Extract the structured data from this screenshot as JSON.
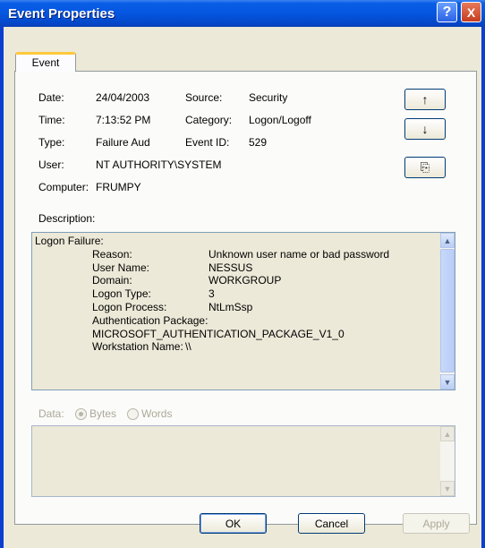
{
  "window": {
    "title": "Event Properties"
  },
  "title_buttons": {
    "help": "?",
    "close": "X"
  },
  "tabs": [
    {
      "label": "Event"
    }
  ],
  "fields": {
    "date_label": "Date:",
    "date_value": "24/04/2003",
    "source_label": "Source:",
    "source_value": "Security",
    "time_label": "Time:",
    "time_value": "7:13:52 PM",
    "category_label": "Category:",
    "category_value": "Logon/Logoff",
    "type_label": "Type:",
    "type_value": "Failure Aud",
    "eventid_label": "Event ID:",
    "eventid_value": "529",
    "user_label": "User:",
    "user_value": "NT AUTHORITY\\SYSTEM",
    "computer_label": "Computer:",
    "computer_value": "FRUMPY"
  },
  "side_buttons": {
    "up": "↑",
    "down": "↓",
    "copy": "⎘"
  },
  "description": {
    "label": "Description:",
    "lines": [
      {
        "indent": 0,
        "key": "Logon Failure:",
        "value": ""
      },
      {
        "indent": 1,
        "key": "Reason:",
        "value": "Unknown user name or bad password"
      },
      {
        "indent": 1,
        "key": "User Name:",
        "value": "NESSUS"
      },
      {
        "indent": 1,
        "key": "Domain:",
        "value": "WORKGROUP"
      },
      {
        "indent": 1,
        "key": "Logon Type:",
        "value": "3"
      },
      {
        "indent": 1,
        "key": "Logon Process:",
        "value": "NtLmSsp"
      },
      {
        "indent": 1,
        "key": "Authentication Package:",
        "value": ""
      },
      {
        "indent": 1,
        "key": "MICROSOFT_AUTHENTICATION_PACKAGE_V1_0",
        "value": ""
      },
      {
        "indent": 1,
        "key": "Workstation Name:",
        "value": "\\\\"
      }
    ]
  },
  "data_section": {
    "label": "Data:",
    "bytes_label": "Bytes",
    "words_label": "Words",
    "selected": "Bytes"
  },
  "buttons": {
    "ok": "OK",
    "cancel": "Cancel",
    "apply": "Apply"
  },
  "colors": {
    "title_bar": "#0556e0",
    "dialog_bg": "#ece9d8",
    "tab_highlight": "#ffc83c"
  }
}
